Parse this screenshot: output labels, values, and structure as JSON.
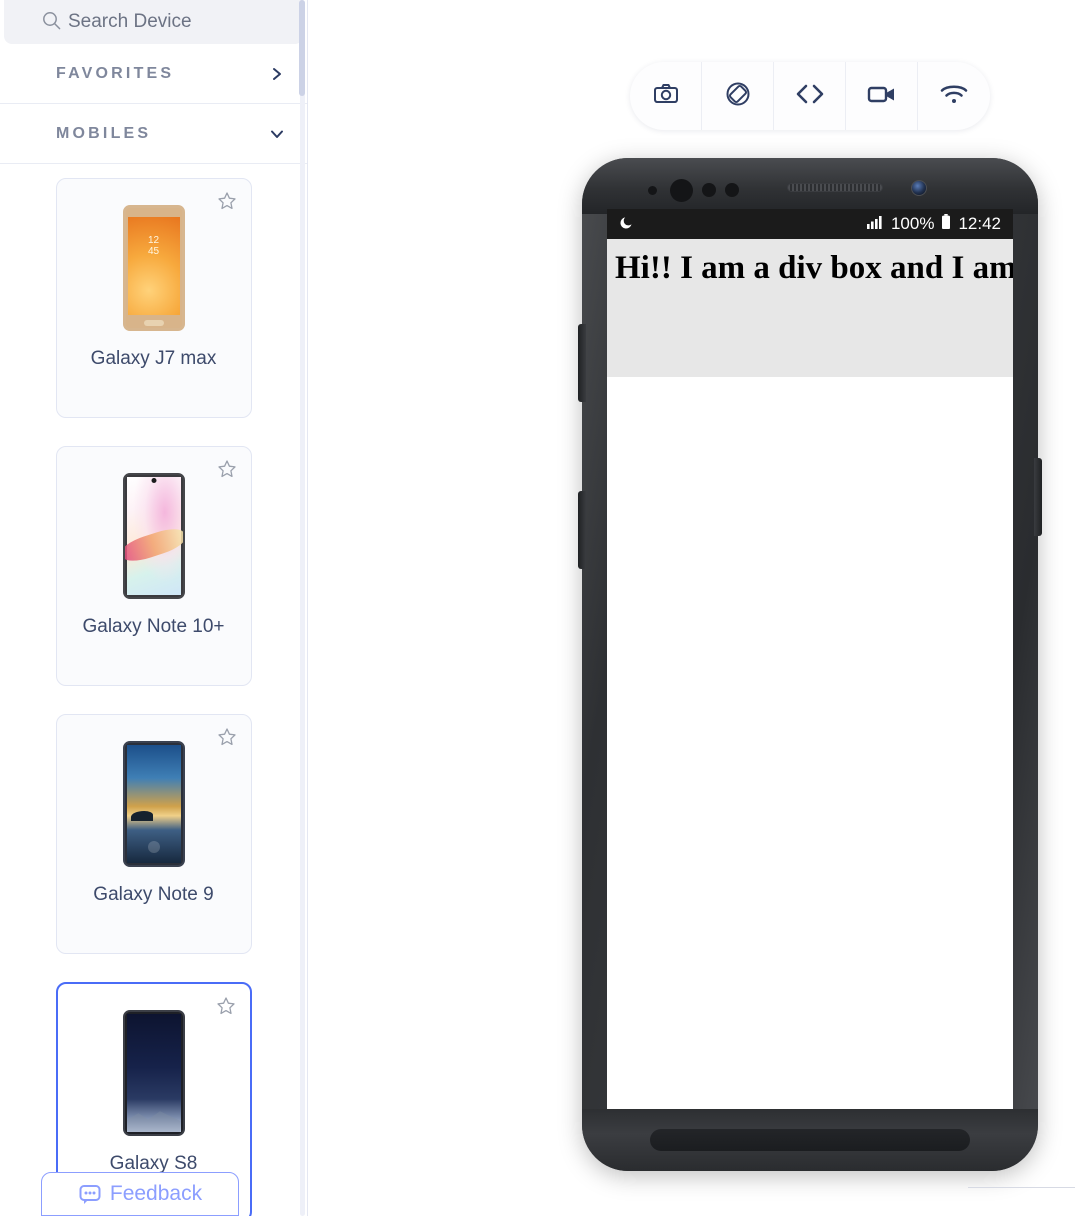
{
  "search": {
    "placeholder": "Search Device",
    "value": "",
    "icon": "search-icon"
  },
  "sidebar": {
    "sections": [
      {
        "title": "FAVORITES",
        "chevron": "chevron-right-icon",
        "expanded": false
      },
      {
        "title": "MOBILES",
        "chevron": "chevron-down-icon",
        "expanded": true
      }
    ],
    "devices": [
      {
        "name": "Galaxy J7 max",
        "selected": false,
        "favorite": false,
        "thumb_time": "12",
        "thumb_time2": "45"
      },
      {
        "name": "Galaxy Note 10+",
        "selected": false,
        "favorite": false
      },
      {
        "name": "Galaxy Note 9",
        "selected": false,
        "favorite": false
      },
      {
        "name": "Galaxy S8",
        "selected": true,
        "favorite": false
      }
    ],
    "feedback_label": "Feedback",
    "feedback_icon": "chat-bubble-icon",
    "star_icon": "star-outline-icon"
  },
  "toolbar": {
    "buttons": [
      {
        "name": "screenshot",
        "icon": "camera-icon"
      },
      {
        "name": "rotate",
        "icon": "rotate-device-icon"
      },
      {
        "name": "inspect",
        "icon": "code-brackets-icon"
      },
      {
        "name": "record",
        "icon": "video-camera-icon"
      },
      {
        "name": "network",
        "icon": "wifi-icon"
      }
    ]
  },
  "device_screen": {
    "status_bar": {
      "left_icon": "dnd-moon-icon",
      "signal_icon": "signal-bars-icon",
      "battery_percent": "100%",
      "battery_icon": "battery-full-icon",
      "time": "12:42"
    },
    "content": {
      "div_text": "Hi!! I am a div box and I am a"
    }
  },
  "colors": {
    "accent": "#4a6cf7",
    "feedback": "#8c9eff",
    "section_title": "#7f879c",
    "device_name": "#3d4a6b",
    "toolbar_icon": "#2f3e63",
    "divbox_bg": "#e7e7e7"
  }
}
